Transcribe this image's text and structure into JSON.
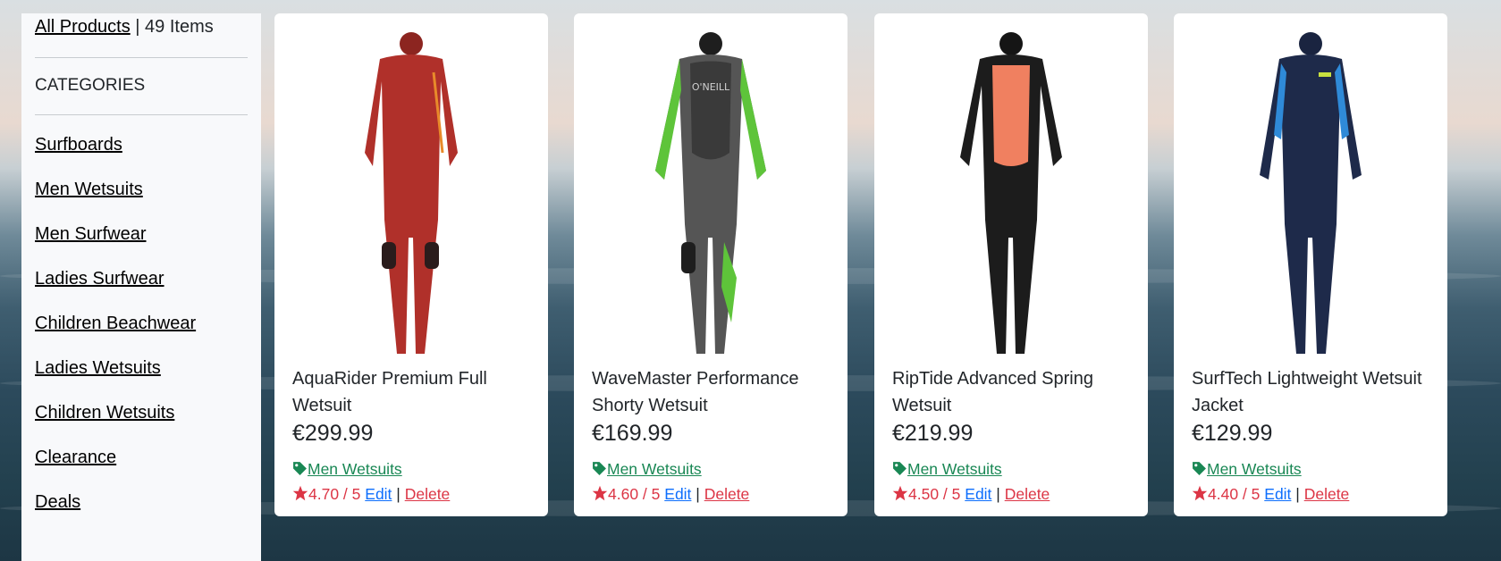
{
  "sidebar": {
    "breadcrumb_link": "All Products",
    "breadcrumb_count": " | 49 Items",
    "categories_heading": "CATEGORIES",
    "categories": [
      "Surfboards",
      "Men Wetsuits",
      "Men Surfwear",
      "Ladies Surfwear",
      "Children Beachwear",
      "Ladies Wetsuits",
      "Children Wetsuits",
      "Clearance",
      "Deals"
    ]
  },
  "products": [
    {
      "name": "AquaRider Premium Full Wetsuit",
      "price": "€299.99",
      "category": "Men Wetsuits",
      "rating": "4.70 / 5",
      "edit": "Edit",
      "delete": "Delete",
      "suit_color": "#b0302a"
    },
    {
      "name": "WaveMaster Performance Shorty Wetsuit",
      "price": "€169.99",
      "category": "Men Wetsuits",
      "rating": "4.60 / 5",
      "edit": "Edit",
      "delete": "Delete",
      "suit_color": "#555555"
    },
    {
      "name": "RipTide Advanced Spring Wetsuit",
      "price": "€219.99",
      "category": "Men Wetsuits",
      "rating": "4.50 / 5",
      "edit": "Edit",
      "delete": "Delete",
      "suit_color": "#1c1c1c"
    },
    {
      "name": "SurfTech Lightweight Wetsuit Jacket",
      "price": "€129.99",
      "category": "Men Wetsuits",
      "rating": "4.40 / 5",
      "edit": "Edit",
      "delete": "Delete",
      "suit_color": "#1e2a4a"
    }
  ],
  "colors": {
    "category_green": "#198754",
    "rating_red": "#dc3545",
    "edit_blue": "#0d6efd"
  },
  "icons": {
    "category": "tag-icon",
    "rating": "star-icon"
  }
}
